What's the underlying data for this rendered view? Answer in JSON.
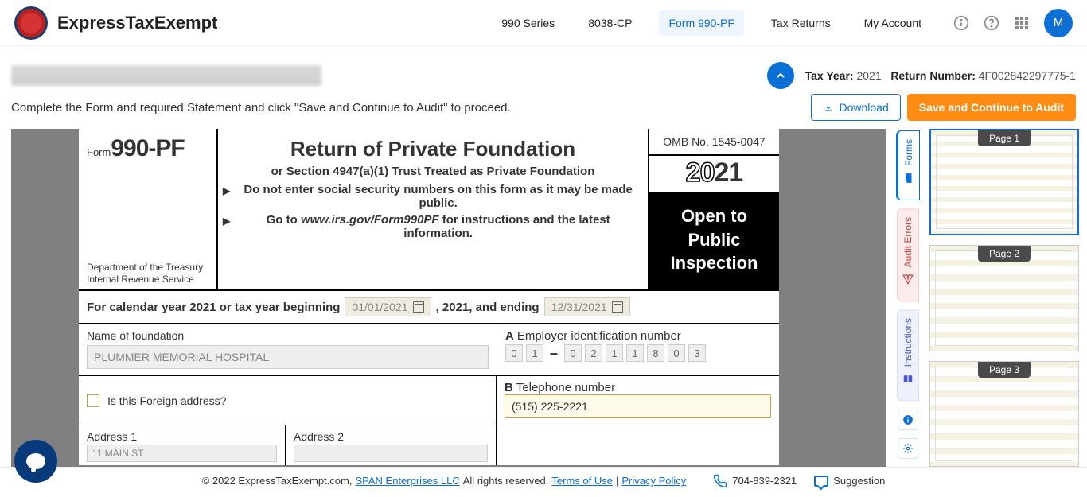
{
  "brand": "ExpressTaxExempt",
  "nav": {
    "series": "990 Series",
    "cp": "8038-CP",
    "pf": "Form 990-PF",
    "returns": "Tax Returns",
    "account": "My Account"
  },
  "avatar": "M",
  "meta": {
    "taxYearLabel": "Tax Year:",
    "taxYear": "2021",
    "returnLabel": "Return Number:",
    "returnNumber": "4F002842297775-1"
  },
  "instruction": "Complete the Form and required Statement and click \"Save and Continue to Audit\" to proceed.",
  "buttons": {
    "download": "Download",
    "save": "Save and Continue to Audit"
  },
  "form": {
    "formWord": "Form",
    "formNumber": "990-PF",
    "dept1": "Department of the Treasury",
    "dept2": "Internal Revenue Service",
    "title": "Return of Private Foundation",
    "subtitle": "or Section 4947(a)(1) Trust Treated as Private Foundation",
    "note1": "Do not enter social security numbers on this form as it may be made public.",
    "note2a": "Go to ",
    "note2b": "www.irs.gov/Form990PF",
    "note2c": " for instructions and the latest information.",
    "omb": "OMB No. 1545-0047",
    "yearPrefix": "20",
    "yearSuffix": "21",
    "open": "Open to Public Inspection",
    "calPrefix": "For calendar year 2021 or tax year beginning",
    "calMid": ", 2021, and ending",
    "dateStart": "01/01/2021",
    "dateEnd": "12/31/2021",
    "nameLabel": "Name of foundation",
    "nameValue": "PLUMMER MEMORIAL HOSPITAL",
    "einLabel": "Employer identification number",
    "einA": "A",
    "ein": [
      "0",
      "1",
      "0",
      "2",
      "1",
      "1",
      "8",
      "0",
      "3"
    ],
    "foreignLabel": "Is this Foreign address?",
    "telLabel": "Telephone number",
    "telB": "B",
    "telValue": "(515) 225-2221",
    "addr1Label": "Address 1",
    "addr1Value": "11 MAIN ST",
    "addr2Label": "Address 2"
  },
  "rail": {
    "forms": "Forms",
    "errors": "Audit Errors",
    "instructions": "Instructions"
  },
  "pages": {
    "p1": "Page 1",
    "p2": "Page 2",
    "p3": "Page 3"
  },
  "footer": {
    "copyright": "© 2022 ExpressTaxExempt.com, ",
    "span": "SPAN Enterprises LLC",
    "rights": " All rights reserved. ",
    "terms": "Terms of Use",
    "sep": " | ",
    "privacy": "Privacy Policy",
    "phone": "704-839-2321",
    "suggestion": "Suggestion"
  }
}
